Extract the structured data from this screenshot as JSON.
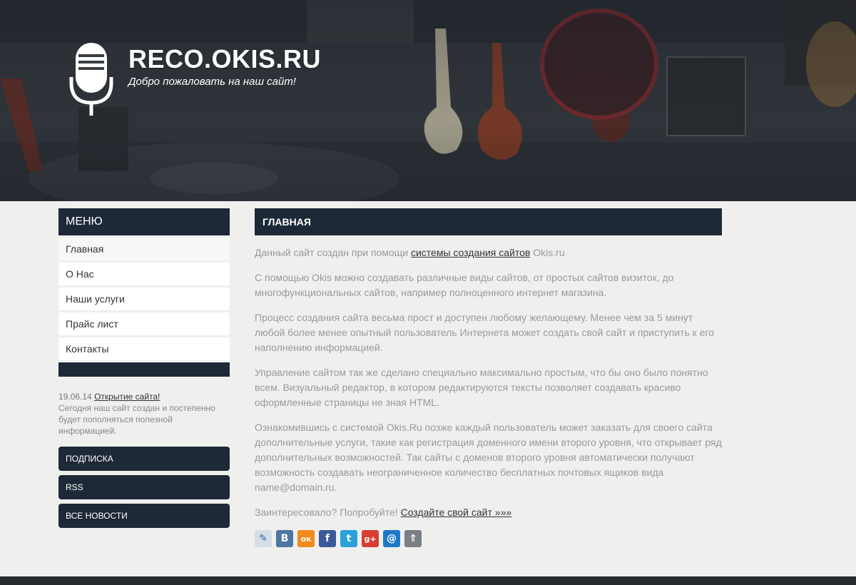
{
  "header": {
    "title": "RECO.OKIS.RU",
    "slogan": "Добро пожаловать на наш сайт!"
  },
  "sidebar": {
    "menu_title": "МЕНЮ",
    "items": [
      {
        "label": "Главная"
      },
      {
        "label": "О Нас"
      },
      {
        "label": "Наши услуги"
      },
      {
        "label": "Прайс лист"
      },
      {
        "label": "Контакты"
      }
    ],
    "news": {
      "date": "19.06.14",
      "link": "Открытие сайта!",
      "text": "Сегодня наш сайт создан и постепенно будет пополняться полезной информацией."
    },
    "buttons": [
      {
        "label": "ПОДПИСКА"
      },
      {
        "label": "RSS"
      },
      {
        "label": "ВСЕ НОВОСТИ"
      }
    ]
  },
  "main": {
    "title": "ГЛАВНАЯ",
    "p1_before": "Данный сайт создан при помощи ",
    "p1_link": "системы создания сайтов",
    "p1_after": " Okis.ru",
    "p2": "С помощью Okis можно создавать различные виды сайтов, от простых сайтов визиток, до многофункциональных сайтов, например полноценного интернет магазина.",
    "p3": "Процесс создания сайта весьма прост и доступен любому желающему. Менее чем за 5 минут любой более менее опытный пользователь Интернета может создать свой сайт и приступить к его наполнению информацией.",
    "p4": "Управление сайтом так же сделано специально максимально простым, что бы оно было понятно всем. Визуальный редактор, в котором редактируются тексты позволяет создавать красиво оформленные страницы не зная HTML.",
    "p5": "Ознакомившись с системой Okis.Ru позже каждый пользователь может заказать для своего сайта дополнительные услуги, такие как регистрация доменного имени второго уровня, что открывает ряд дополнительных возможностей. Так сайты с доменов второго уровня автоматически получают возможность создавать неограниченное количество бесплатных почтовых ящиков вида name@domain.ru.",
    "p6_before": "Заинтересовало? Попробуйте! ",
    "p6_link": "Создайте свой сайт »»»"
  },
  "share": [
    {
      "icon": "livejournal-icon",
      "glyph": "✎",
      "color": "#d6dde6"
    },
    {
      "icon": "vkontakte-icon",
      "glyph": "B",
      "color": "#4d76a1"
    },
    {
      "icon": "odnoklassniki-icon",
      "glyph": "ок",
      "color": "#f28a1c"
    },
    {
      "icon": "facebook-icon",
      "glyph": "f",
      "color": "#3b5998"
    },
    {
      "icon": "twitter-icon",
      "glyph": "t",
      "color": "#2aa2d8"
    },
    {
      "icon": "google-plus-icon",
      "glyph": "g+",
      "color": "#d73d32"
    },
    {
      "icon": "mailru-icon",
      "glyph": "@",
      "color": "#1f78c8"
    },
    {
      "icon": "share-more-icon",
      "glyph": "⇑",
      "color": "#7a7f85"
    }
  ]
}
